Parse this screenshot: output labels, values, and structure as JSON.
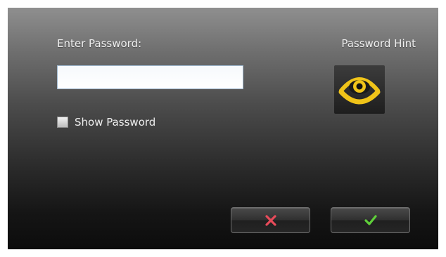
{
  "dialog": {
    "password_label": "Enter Password:",
    "password_value": "",
    "hint_label": "Password Hint",
    "show_password_label": "Show Password",
    "show_password_checked": false
  },
  "icons": {
    "hint": "eye-icon",
    "cancel": "x-icon",
    "ok": "checkmark-icon"
  },
  "colors": {
    "eye_yellow": "#f0c419",
    "cancel_red": "#e84b5a",
    "ok_green": "#5fcf3a"
  }
}
